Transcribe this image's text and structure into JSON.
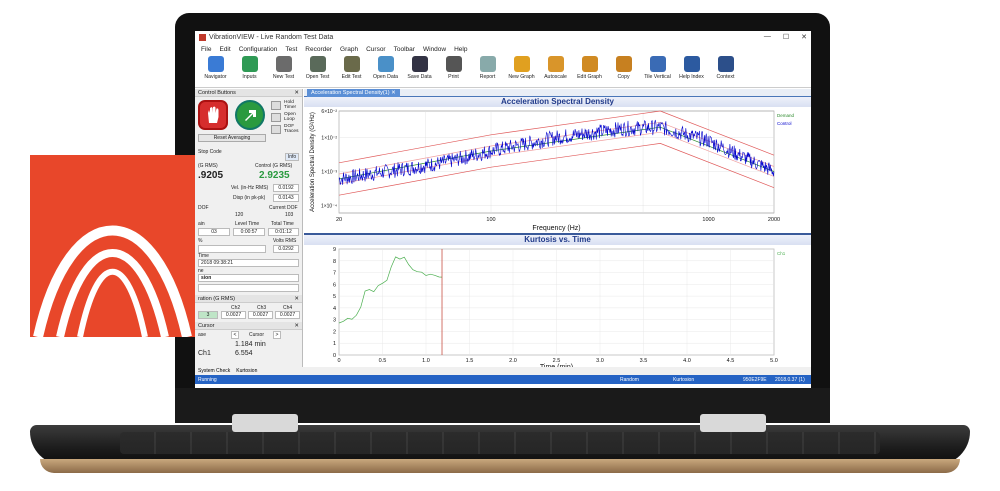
{
  "window": {
    "title": "VibrationVIEW - Live Random Test Data",
    "controls": [
      "—",
      "☐",
      "✕"
    ]
  },
  "menu": [
    "File",
    "Edit",
    "Configuration",
    "Test",
    "Recorder",
    "Graph",
    "Cursor",
    "Toolbar",
    "Window",
    "Help"
  ],
  "toolbar": [
    {
      "label": "Navigator",
      "icon": "navigator-icon",
      "color": "#3a7bd5"
    },
    {
      "label": "Inputs",
      "icon": "inputs-icon",
      "color": "#2f9a55"
    },
    {
      "label": "New Test",
      "icon": "new-test-icon",
      "color": "#6b6b6b"
    },
    {
      "label": "Open Test",
      "icon": "open-test-icon",
      "color": "#5a6a5a"
    },
    {
      "label": "Edit Test",
      "icon": "edit-test-icon",
      "color": "#6a6a4a"
    },
    {
      "label": "Open Data",
      "icon": "open-data-icon",
      "color": "#4a90c8"
    },
    {
      "label": "Save Data",
      "icon": "save-data-icon",
      "color": "#334"
    },
    {
      "label": "Print",
      "icon": "print-icon",
      "color": "#555"
    },
    {
      "label": "Report",
      "icon": "report-icon",
      "color": "#8aa"
    },
    {
      "label": "New Graph",
      "icon": "new-graph-icon",
      "color": "#e0a020"
    },
    {
      "label": "Autoscale",
      "icon": "autoscale-icon",
      "color": "#d9952a"
    },
    {
      "label": "Edit Graph",
      "icon": "edit-graph-icon",
      "color": "#d08a22"
    },
    {
      "label": "Copy",
      "icon": "copy-icon",
      "color": "#c78020"
    },
    {
      "label": "Tile Vertical",
      "icon": "tile-vertical-icon",
      "color": "#3a6bb5"
    },
    {
      "label": "Help Index",
      "icon": "help-index-icon",
      "color": "#2c5aa0"
    },
    {
      "label": "Context",
      "icon": "context-icon",
      "color": "#2c4f8a"
    }
  ],
  "left": {
    "control_buttons": "Control Buttons",
    "hold_timer": "Hold Timer",
    "open_loop": "Open Loop",
    "dof_traces": "DOF Traces",
    "reset_averaging": "Reset Averaging",
    "stop_code": "Stop Code",
    "info": "Info",
    "demand_label": "(G RMS)",
    "control_label": "Control (G RMS)",
    "demand_value": ".9205",
    "control_value": "2.9235",
    "vel_label": "Vel. (in-Hz RMS)",
    "vel_value": "0.0192",
    "disp_label": "Disp (in pk-pk)",
    "disp_value": "0.0143",
    "dof_label": "DOF",
    "current_dof_label": "Current DOF",
    "dof_value": "120",
    "current_dof_value": "103",
    "gain_label": "ain",
    "level_time_label": "Level Time",
    "total_time_label": "Total Time",
    "gain_value": "03",
    "level_time_value": "0:00:57",
    "total_time_value": "0:01:12",
    "volts_label": "Volts RMS",
    "volts_value": "0.0292",
    "pct_label": "%",
    "time_label": "Time",
    "time_value": "2018 09:38:21",
    "ne_label": "ne",
    "sion_label": "sion",
    "ch_header": "ration (G RMS)",
    "ch_cols": [
      "Ch2",
      "Ch3",
      "Ch4"
    ],
    "ch_values": [
      "3",
      "0.0027",
      "0.0027",
      "0.0027"
    ],
    "cursor_header": "Cursor",
    "cursor_label": "Cursor",
    "ase_label": "ase",
    "cursor_x": "1.184 min",
    "cursor_ch": "Ch1",
    "cursor_ch_value": "6.554"
  },
  "doc_tab": "Acceleration Spectral Density(1)",
  "bottom_tabs": [
    "System Check",
    "Kurtosion"
  ],
  "status": {
    "left": "Running",
    "mid1": "Random",
    "mid2": "Kurtosion",
    "right1": "950E2F9E",
    "right2": "2018.0.37 (1)"
  },
  "chart_data": [
    {
      "type": "line",
      "title": "Acceleration Spectral Density",
      "xlabel": "Frequency (Hz)",
      "ylabel": "Acceleration Spectral Density (G²/Hz)",
      "x_scale": "log",
      "y_scale": "log",
      "xlim": [
        20,
        2000
      ],
      "x_ticks": [
        "20",
        "100",
        "1000",
        "2000"
      ],
      "y_ticks": [
        "6×10⁻²",
        "1×10⁻²",
        "1×10⁻³",
        "1×10⁻⁴"
      ],
      "legend": [
        "Demand",
        "Control"
      ],
      "legend_position": "top-right",
      "series": [
        {
          "name": "Demand",
          "color": "#2e8b2e",
          "x": [
            20,
            100,
            600,
            2000
          ],
          "y": [
            0.0006,
            0.004,
            0.02,
            0.001
          ]
        },
        {
          "name": "Control",
          "color": "#0000cc",
          "x": [
            20,
            60,
            100,
            200,
            400,
            600,
            1000,
            2000
          ],
          "y": [
            0.0006,
            0.0018,
            0.004,
            0.01,
            0.018,
            0.02,
            0.008,
            0.001
          ]
        }
      ],
      "grid": true
    },
    {
      "type": "line",
      "title": "Kurtosis vs. Time",
      "xlabel": "Time (min)",
      "ylim": [
        0,
        9
      ],
      "xlim": [
        0,
        5
      ],
      "x_ticks": [
        "0",
        "0.5",
        "1.0",
        "1.5",
        "2.0",
        "2.5",
        "3.0",
        "3.5",
        "4.0",
        "4.5",
        "5.0"
      ],
      "y_ticks": [
        "0",
        "1",
        "2",
        "3",
        "4",
        "5",
        "6",
        "7",
        "8",
        "9"
      ],
      "legend": [
        "Ch1"
      ],
      "legend_position": "top-right",
      "series": [
        {
          "name": "Ch1",
          "color": "#4caf50",
          "x": [
            0,
            0.05,
            0.1,
            0.15,
            0.2,
            0.25,
            0.3,
            0.35,
            0.4,
            0.45,
            0.5,
            0.55,
            0.6,
            0.65,
            0.7,
            0.75,
            0.8,
            0.85,
            0.9,
            0.95,
            1.0,
            1.05,
            1.1,
            1.15,
            1.184
          ],
          "y": [
            2.8,
            3.0,
            2.9,
            3.1,
            3.3,
            4.2,
            5.2,
            5.6,
            5.4,
            5.9,
            6.0,
            6.3,
            7.5,
            8.3,
            8.1,
            8.4,
            7.6,
            7.2,
            7.0,
            7.1,
            6.8,
            6.9,
            6.7,
            6.6,
            6.554
          ]
        }
      ],
      "cursor_x": 1.184,
      "grid": true
    }
  ]
}
